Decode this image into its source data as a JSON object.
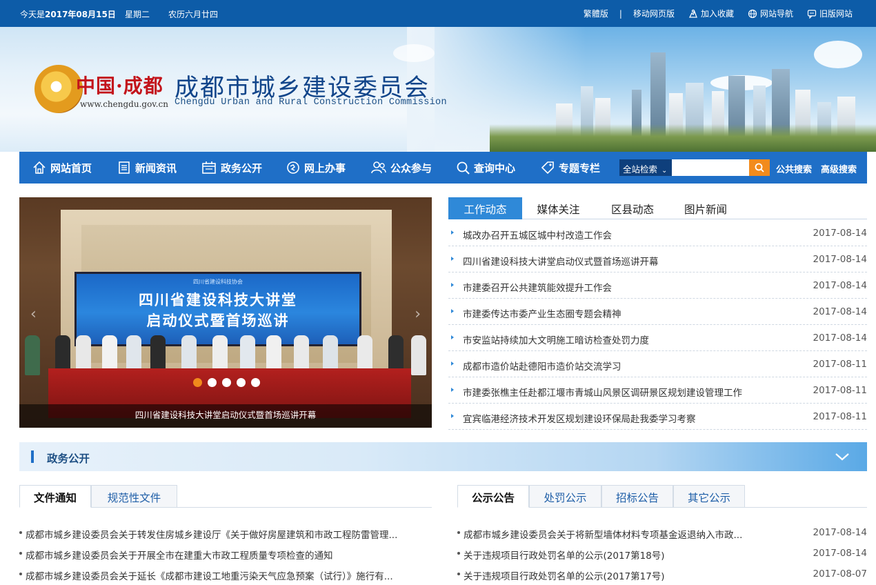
{
  "topbar": {
    "date_prefix": "今天是",
    "date": "2017年08月15日",
    "weekday": "星期二",
    "lunar": "农历六月廿四",
    "links": [
      {
        "label": "繁體版",
        "icon": "none"
      },
      {
        "label": "移动网页版",
        "icon": "none"
      },
      {
        "label": "加入收藏",
        "icon": "favorite-icon"
      },
      {
        "label": "网站导航",
        "icon": "globe-icon"
      },
      {
        "label": "旧版网站",
        "icon": "chat-icon"
      }
    ],
    "separator": "|"
  },
  "banner": {
    "logo_cn": "中国·成都",
    "logo_url": "www.chengdu.gov.cn",
    "title": "成都市城乡建设委员会",
    "title_en": "Chengdu Urban and Rural Construction Commission"
  },
  "nav": {
    "items": [
      {
        "label": "网站首页",
        "icon": "home-icon"
      },
      {
        "label": "新闻资讯",
        "icon": "news-icon"
      },
      {
        "label": "政务公开",
        "icon": "gov-icon"
      },
      {
        "label": "网上办事",
        "icon": "service-icon"
      },
      {
        "label": "公众参与",
        "icon": "people-icon"
      },
      {
        "label": "查询中心",
        "icon": "query-icon"
      },
      {
        "label": "专题专栏",
        "icon": "tag-icon"
      }
    ],
    "search_scope": "全站检索",
    "search_placeholder": "",
    "public_search": "公共搜索",
    "advanced_search": "高级搜索"
  },
  "slider": {
    "screen_header": "四川省建设科技协会",
    "screen_line1": "四川省建设科技大讲堂",
    "screen_line2": "启动仪式暨首场巡讲",
    "caption": "四川省建设科技大讲堂启动仪式暨首场巡讲开幕",
    "slide_count": 5,
    "active_index": 0
  },
  "news": {
    "tabs": [
      "工作动态",
      "媒体关注",
      "区县动态",
      "图片新闻"
    ],
    "active_tab": 0,
    "items": [
      {
        "title": "城改办召开五城区城中村改造工作会",
        "date": "2017-08-14"
      },
      {
        "title": "四川省建设科技大讲堂启动仪式暨首场巡讲开幕",
        "date": "2017-08-14"
      },
      {
        "title": "市建委召开公共建筑能效提升工作会",
        "date": "2017-08-14"
      },
      {
        "title": "市建委传达市委产业生态圈专题会精神",
        "date": "2017-08-14"
      },
      {
        "title": "市安监站持续加大文明施工暗访检查处罚力度",
        "date": "2017-08-14"
      },
      {
        "title": "成都市造价站赴德阳市造价站交流学习",
        "date": "2017-08-11"
      },
      {
        "title": "市建委张樵主任赴都江堰市青城山风景区调研景区规划建设管理工作",
        "date": "2017-08-11"
      },
      {
        "title": "宜宾临港经济技术开发区规划建设环保局赴我委学习考察",
        "date": "2017-08-11"
      }
    ]
  },
  "section": {
    "title": "政务公开"
  },
  "docs_left": {
    "tabs": [
      "文件通知",
      "规范性文件"
    ],
    "active_tab": 0,
    "items": [
      {
        "title": "成都市城乡建设委员会关于转发住房城乡建设厅《关于做好房屋建筑和市政工程防雷管理..."
      },
      {
        "title": "成都市城乡建设委员会关于开展全市在建重大市政工程质量专项检查的通知"
      },
      {
        "title": "成都市城乡建设委员会关于延长《成都市建设工地重污染天气应急预案（试行）》施行有..."
      }
    ]
  },
  "docs_right": {
    "tabs": [
      "公示公告",
      "处罚公示",
      "招标公告",
      "其它公示"
    ],
    "active_tab": 0,
    "items": [
      {
        "title": "成都市城乡建设委员会关于将新型墙体材料专项基金返退纳入市政...",
        "date": "2017-08-14"
      },
      {
        "title": "关于违规项目行政处罚名单的公示(2017第18号)",
        "date": "2017-08-14"
      },
      {
        "title": "关于违规项目行政处罚名单的公示(2017第17号)",
        "date": "2017-08-07"
      }
    ]
  }
}
